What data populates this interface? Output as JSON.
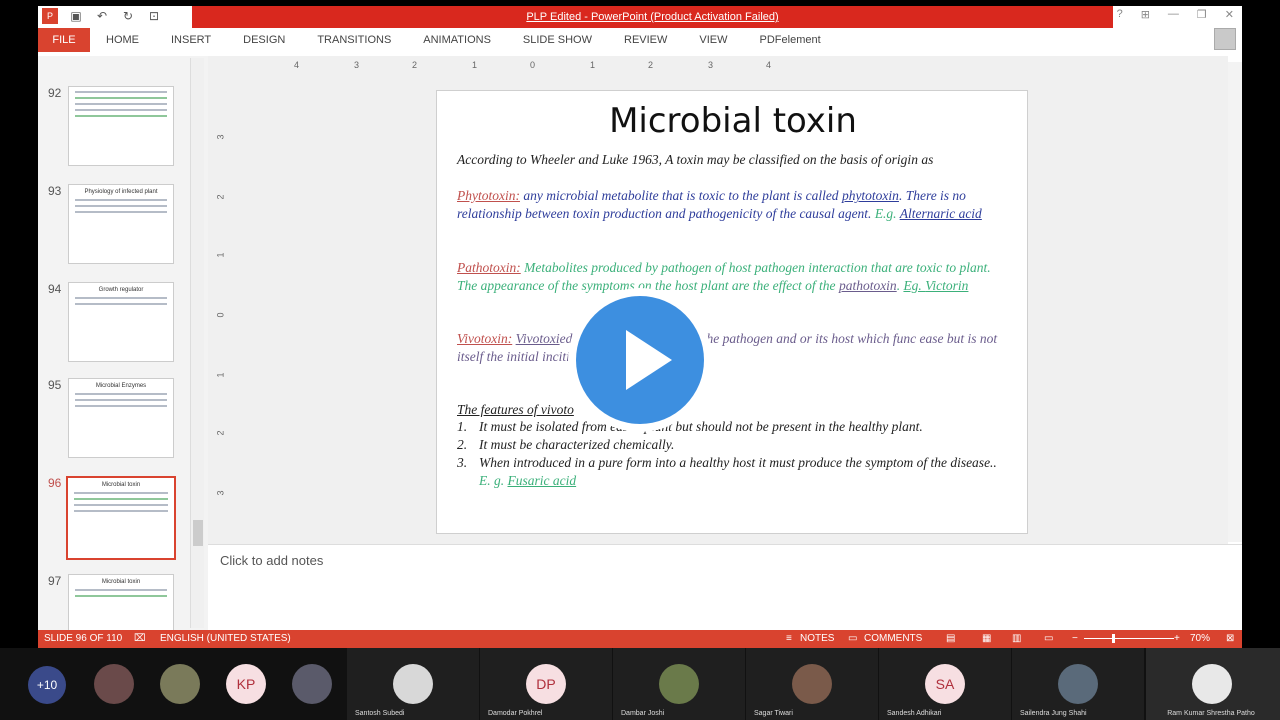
{
  "window": {
    "title": "PLP Edited - PowerPoint (Product Activation Failed)"
  },
  "ribbon": {
    "file_label": "FILE",
    "tabs": [
      "HOME",
      "INSERT",
      "DESIGN",
      "TRANSITIONS",
      "ANIMATIONS",
      "SLIDE SHOW",
      "REVIEW",
      "VIEW",
      "PDFelement"
    ]
  },
  "thumbnails": [
    {
      "num": "92",
      "title": ""
    },
    {
      "num": "93",
      "title": "Physiology of infected plant"
    },
    {
      "num": "94",
      "title": "Growth regulator"
    },
    {
      "num": "95",
      "title": "Microbial Enzymes"
    },
    {
      "num": "96",
      "title": "Microbial toxin"
    },
    {
      "num": "97",
      "title": "Microbial toxin"
    }
  ],
  "ruler": {
    "h": [
      "4",
      "3",
      "2",
      "1",
      "0",
      "1",
      "2",
      "3",
      "4"
    ],
    "v": [
      "3",
      "2",
      "1",
      "0",
      "1",
      "2",
      "3"
    ]
  },
  "slide": {
    "title": "Microbial toxin",
    "intro": "According to Wheeler and Luke 1963, A toxin may be classified on the basis of origin as",
    "phyto_term": "Phytotoxin:",
    "phyto_text1": " any microbial metabolite that is toxic to the plant is called ",
    "phyto_word": "phytotoxin",
    "phyto_text2": ". There is no relationship between toxin production and pathogenicity of the causal agent. ",
    "phyto_eg": "E.g. ",
    "phyto_example": "Alternaric acid",
    "patho_term": "Pathotoxin:",
    "patho_text1": " Metabolites produced by pathogen of host pathogen interaction that are toxic to plant. The appearance of the symptoms on the host plant are the effect of the ",
    "patho_word": "pathotoxin",
    "patho_text2": ". ",
    "patho_eg": "Eg. ",
    "patho_example": "Victorin",
    "vivo_term": "Vivotoxin:",
    "vivo_word": "Vivotoxi",
    "vivo_text": "ed in the infected plant by the pathogen and or its host which func                      ease but is not itself the initial inciting agent of the disease.",
    "features_heading": "The features of vivoto",
    "features": [
      {
        "n": "1.",
        "text": "It must be isolated from          eased plant but should not be present in the healthy plant."
      },
      {
        "n": "2.",
        "text": " It must be characterized chemically."
      },
      {
        "n": "3.",
        "text": "When introduced in a pure form into a healthy host it must produce the symptom of the disease.. "
      }
    ],
    "f3_eg": "E. g. ",
    "f3_example": "Fusaric acid"
  },
  "notes": {
    "placeholder": "Click to add notes"
  },
  "status": {
    "slide": "SLIDE 96 OF 110",
    "language": "ENGLISH (UNITED STATES)",
    "notes": "NOTES",
    "comments": "COMMENTS",
    "zoom": "70%"
  },
  "participants": {
    "more": "+10",
    "named": [
      {
        "initials": "",
        "name": "Santosh Subedi"
      },
      {
        "initials": "DP",
        "name": "Damodar Pokhrel"
      },
      {
        "initials": "",
        "name": "Dambar Joshi"
      },
      {
        "initials": "",
        "name": "Sagar Tiwari"
      },
      {
        "initials": "SA",
        "name": "Sandesh Adhikari"
      },
      {
        "initials": "",
        "name": "Sailendra Jung Shahi"
      },
      {
        "initials": "",
        "name": "Ram Kumar Shrestha Patho"
      }
    ],
    "small": [
      {
        "initials": ""
      },
      {
        "initials": ""
      },
      {
        "initials": "KP"
      },
      {
        "initials": ""
      }
    ]
  },
  "colors": {
    "title_bar": "#d9281e",
    "accent": "#d9432f",
    "play": "#3d8fe0"
  }
}
